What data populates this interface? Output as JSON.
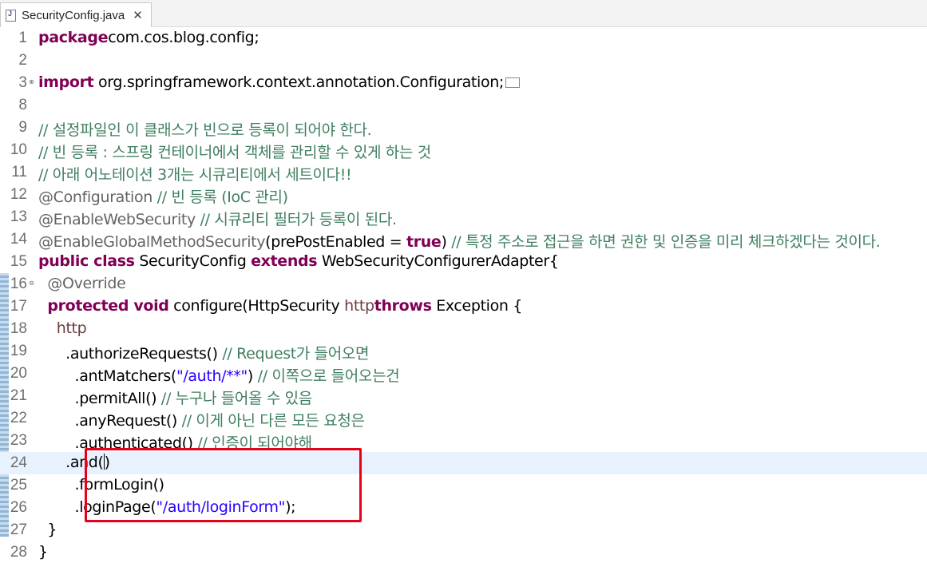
{
  "tab": {
    "file_name": "SecurityConfig.java",
    "close_symbol": "✕",
    "file_icon": "java-file-icon"
  },
  "colors": {
    "keyword": "#7f0055",
    "comment": "#3f7f5f",
    "string": "#2a00ff",
    "annotation": "#646464",
    "current_line": "#e8f2fe",
    "highlight_box": "#e8001a"
  },
  "lines": [
    {
      "n": "1",
      "seg": [
        [
          "kw",
          "package"
        ],
        [
          "",
          "com.cos.blog.config;"
        ]
      ]
    },
    {
      "n": "2",
      "seg": [
        [
          "",
          ""
        ]
      ]
    },
    {
      "n": "3",
      "seg": [
        [
          "kw",
          "import"
        ],
        [
          "",
          " org.springframework.context.annotation.Configuration;"
        ]
      ]
    },
    {
      "n": "8",
      "seg": [
        [
          "",
          ""
        ]
      ]
    },
    {
      "n": "9",
      "seg": [
        [
          "cm",
          "// 설정파일인 이 클래스가 빈으로 등록이 되어야 한다."
        ]
      ]
    },
    {
      "n": "10",
      "seg": [
        [
          "cm",
          "// 빈 등록 : 스프링 컨테이너에서 객체를 관리할 수 있게 하는 것"
        ]
      ]
    },
    {
      "n": "11",
      "seg": [
        [
          "cm",
          "// 아래 어노테이션 3개는 시큐리티에서 세트이다!!"
        ]
      ]
    },
    {
      "n": "12",
      "seg": [
        [
          "an",
          "@Configuration"
        ],
        [
          "cm",
          " // 빈 등록 (IoC 관리)"
        ]
      ]
    },
    {
      "n": "13",
      "seg": [
        [
          "an",
          "@EnableWebSecurity"
        ],
        [
          "cm",
          " // 시큐리티 필터가 등록이 된다."
        ]
      ]
    },
    {
      "n": "14",
      "seg": [
        [
          "an",
          "@EnableGlobalMethodSecurity"
        ],
        [
          "",
          "(prePostEnabled = "
        ],
        [
          "kw",
          "true"
        ],
        [
          "",
          ")"
        ],
        [
          "cm",
          " // 특정 주소로 접근을 하면 권한 및 인증을 미리 체크하겠다는 것이다."
        ]
      ]
    },
    {
      "n": "15",
      "seg": [
        [
          "kw",
          "public class"
        ],
        [
          "",
          " SecurityConfig "
        ],
        [
          "kw",
          "extends"
        ],
        [
          "",
          " WebSecurityConfigurerAdapter{"
        ]
      ]
    },
    {
      "n": "16",
      "seg": [
        [
          "",
          "  "
        ],
        [
          "an",
          "@Override"
        ]
      ]
    },
    {
      "n": "17",
      "seg": [
        [
          "",
          "  "
        ],
        [
          "kw",
          "protected void"
        ],
        [
          "",
          " configure(HttpSecurity "
        ],
        [
          "fld",
          "http"
        ],
        [
          ") "
        ],
        [
          "kw",
          "throws"
        ],
        [
          "",
          " Exception {"
        ]
      ]
    },
    {
      "n": "18",
      "seg": [
        [
          "",
          "    "
        ],
        [
          "fld",
          "http"
        ]
      ]
    },
    {
      "n": "19",
      "seg": [
        [
          "",
          "      .authorizeRequests()"
        ],
        [
          "cm",
          " // Request가 들어오면"
        ]
      ]
    },
    {
      "n": "20",
      "seg": [
        [
          "",
          "        .antMatchers("
        ],
        [
          "st",
          "\"/auth/**\""
        ],
        [
          "",
          ")"
        ],
        [
          "cm",
          " // 이쪽으로 들어오는건"
        ]
      ]
    },
    {
      "n": "21",
      "seg": [
        [
          "",
          "        .permitAll()"
        ],
        [
          "cm",
          " // 누구나 들어올 수 있음"
        ]
      ]
    },
    {
      "n": "22",
      "seg": [
        [
          "",
          "        .anyRequest()"
        ],
        [
          "cm",
          " // 이게 아닌 다른 모든 요청은"
        ]
      ]
    },
    {
      "n": "23",
      "seg": [
        [
          "",
          "        .authenticated()"
        ],
        [
          "cm",
          " // 인증이 되어야해"
        ]
      ]
    },
    {
      "n": "24",
      "seg": [
        [
          "",
          "      .and()"
        ]
      ]
    },
    {
      "n": "25",
      "seg": [
        [
          "",
          "        .formLogin()"
        ]
      ]
    },
    {
      "n": "26",
      "seg": [
        [
          "",
          "        .loginPage("
        ],
        [
          "st",
          "\"/auth/loginForm\""
        ],
        [
          "",
          ");"
        ]
      ]
    },
    {
      "n": "27",
      "seg": [
        [
          "",
          "  }"
        ]
      ]
    },
    {
      "n": "28",
      "seg": [
        [
          "",
          "}"
        ]
      ]
    }
  ],
  "fold_markers": {
    "3": "⊕",
    "16": "⊖"
  },
  "current_line": "24"
}
